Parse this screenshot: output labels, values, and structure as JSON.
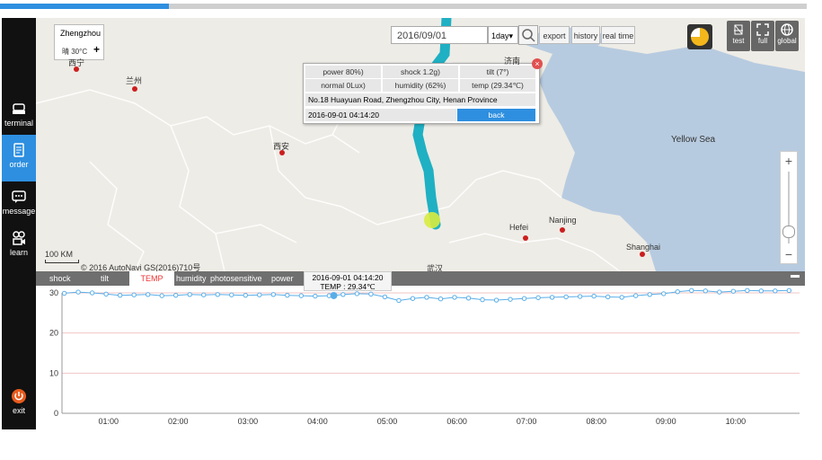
{
  "sidebar": {
    "items": [
      {
        "label": "terminal",
        "icon": "terminal-icon"
      },
      {
        "label": "order",
        "icon": "order-icon"
      },
      {
        "label": "message",
        "icon": "message-icon"
      },
      {
        "label": "learn",
        "icon": "learn-icon"
      },
      {
        "label": "exit",
        "icon": "power-icon"
      }
    ]
  },
  "map": {
    "city_box": {
      "name": "Zhengzhou",
      "weather": "晴 30°C"
    },
    "date_value": "2016/09/01",
    "range_value": "1day",
    "export_label": "export",
    "history_label": "history",
    "realtime_label": "real time",
    "tools": [
      {
        "label": "test",
        "icon": "test-icon"
      },
      {
        "label": "full",
        "icon": "fullscreen-icon"
      },
      {
        "label": "global",
        "icon": "globe-icon"
      }
    ],
    "popup": {
      "power": "power  80%)",
      "shock": "shock  1.2g)",
      "tilt": "tilt  (7°)",
      "normal": "normal  0Lux)",
      "humidity": "humidity (62%)",
      "temp": "temp  (29.34℃)",
      "address": "No.18 Huayuan Road, Zhengzhou City, Henan Province",
      "time": "2016-09-01 04:14:20",
      "back_label": "back"
    },
    "labels": {
      "lanzhou": "兰州",
      "xian": "西安",
      "jinan": "济南",
      "xining": "西宁",
      "yellow_sea": "Yellow Sea",
      "hefei": "Hefei",
      "nanjing": "Nanjing",
      "shanghai": "Shanghai",
      "bottom_city": "武汉"
    },
    "scale": "100 KM",
    "copyright": "© 2016 AutoNavi GS(2016)710号"
  },
  "chart_panel": {
    "tabs": [
      "shock",
      "tilt",
      "TEMP",
      "humidity",
      "photosensitive",
      "power"
    ],
    "active_tab": "TEMP",
    "tooltip_time": "2016-09-01 04:14:20",
    "tooltip_value": "TEMP : 29.34℃"
  },
  "chart_data": {
    "type": "line",
    "title": "",
    "xlabel": "",
    "ylabel": "",
    "xlim": [
      "00:20",
      "10:55"
    ],
    "ylim": [
      0,
      30
    ],
    "yticks": [
      0,
      10,
      20,
      30
    ],
    "xticks": [
      "01:00",
      "02:00",
      "03:00",
      "04:00",
      "05:00",
      "06:00",
      "07:00",
      "08:00",
      "09:00",
      "10:00"
    ],
    "grid": true,
    "highlight": {
      "time": "04:14",
      "value": 29.34
    },
    "series": [
      {
        "color": "#5aaee8",
        "x": [
          "00:22",
          "00:34",
          "00:46",
          "00:58",
          "01:10",
          "01:22",
          "01:34",
          "01:46",
          "01:58",
          "02:10",
          "02:22",
          "02:34",
          "02:46",
          "02:58",
          "03:10",
          "03:22",
          "03:34",
          "03:46",
          "03:58",
          "04:10",
          "04:14",
          "04:22",
          "04:34",
          "04:46",
          "04:58",
          "05:10",
          "05:22",
          "05:34",
          "05:46",
          "05:58",
          "06:10",
          "06:22",
          "06:34",
          "06:46",
          "06:58",
          "07:10",
          "07:22",
          "07:34",
          "07:46",
          "07:58",
          "08:10",
          "08:22",
          "08:34",
          "08:46",
          "08:58",
          "09:10",
          "09:22",
          "09:34",
          "09:46",
          "09:58",
          "10:10",
          "10:22",
          "10:34",
          "10:46"
        ],
        "values": [
          29.9,
          30.2,
          30.0,
          29.7,
          29.4,
          29.5,
          29.6,
          29.3,
          29.4,
          29.6,
          29.5,
          29.6,
          29.5,
          29.4,
          29.5,
          29.6,
          29.4,
          29.3,
          29.2,
          29.3,
          29.34,
          29.6,
          29.8,
          29.7,
          29.0,
          28.1,
          28.6,
          28.9,
          28.5,
          28.9,
          28.7,
          28.3,
          28.2,
          28.4,
          28.6,
          28.8,
          28.9,
          29.0,
          29.1,
          29.2,
          29.0,
          28.9,
          29.3,
          29.6,
          29.8,
          30.3,
          30.6,
          30.5,
          30.2,
          30.4,
          30.6,
          30.5,
          30.5,
          30.6
        ]
      }
    ]
  }
}
